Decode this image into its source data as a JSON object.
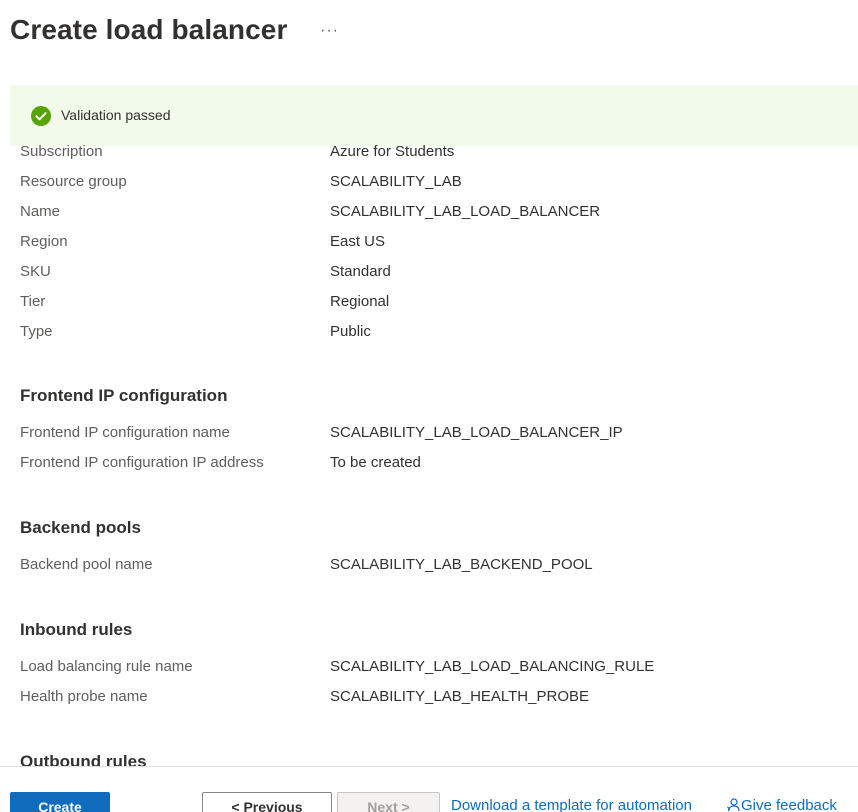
{
  "header": {
    "title": "Create load balancer",
    "more_label": "···"
  },
  "banner": {
    "status": "success",
    "message": "Validation passed",
    "icon": "check-circle-icon",
    "color": "#57a300"
  },
  "basics": [
    {
      "label": "Subscription",
      "value": "Azure for Students"
    },
    {
      "label": "Resource group",
      "value": "SCALABILITY_LAB"
    },
    {
      "label": "Name",
      "value": "SCALABILITY_LAB_LOAD_BALANCER"
    },
    {
      "label": "Region",
      "value": "East US"
    },
    {
      "label": "SKU",
      "value": "Standard"
    },
    {
      "label": "Tier",
      "value": "Regional"
    },
    {
      "label": "Type",
      "value": "Public"
    }
  ],
  "sections": {
    "frontend": {
      "title": "Frontend IP configuration",
      "rows": [
        {
          "label": "Frontend IP configuration name",
          "value": "SCALABILITY_LAB_LOAD_BALANCER_IP"
        },
        {
          "label": "Frontend IP configuration IP address",
          "value": "To be created"
        }
      ]
    },
    "backend": {
      "title": "Backend pools",
      "rows": [
        {
          "label": "Backend pool name",
          "value": "SCALABILITY_LAB_BACKEND_POOL"
        }
      ]
    },
    "inbound": {
      "title": "Inbound rules",
      "rows": [
        {
          "label": "Load balancing rule name",
          "value": "SCALABILITY_LAB_LOAD_BALANCING_RULE"
        },
        {
          "label": "Health probe name",
          "value": "SCALABILITY_LAB_HEALTH_PROBE"
        }
      ]
    },
    "outbound": {
      "title": "Outbound rules"
    }
  },
  "footer": {
    "create_label": "Create",
    "previous_label": "< Previous",
    "next_label": "Next >",
    "template_link": "Download a template for automation",
    "feedback_label": "Give feedback",
    "feedback_icon": "feedback-person-icon",
    "accent": "#0f6cbd"
  }
}
